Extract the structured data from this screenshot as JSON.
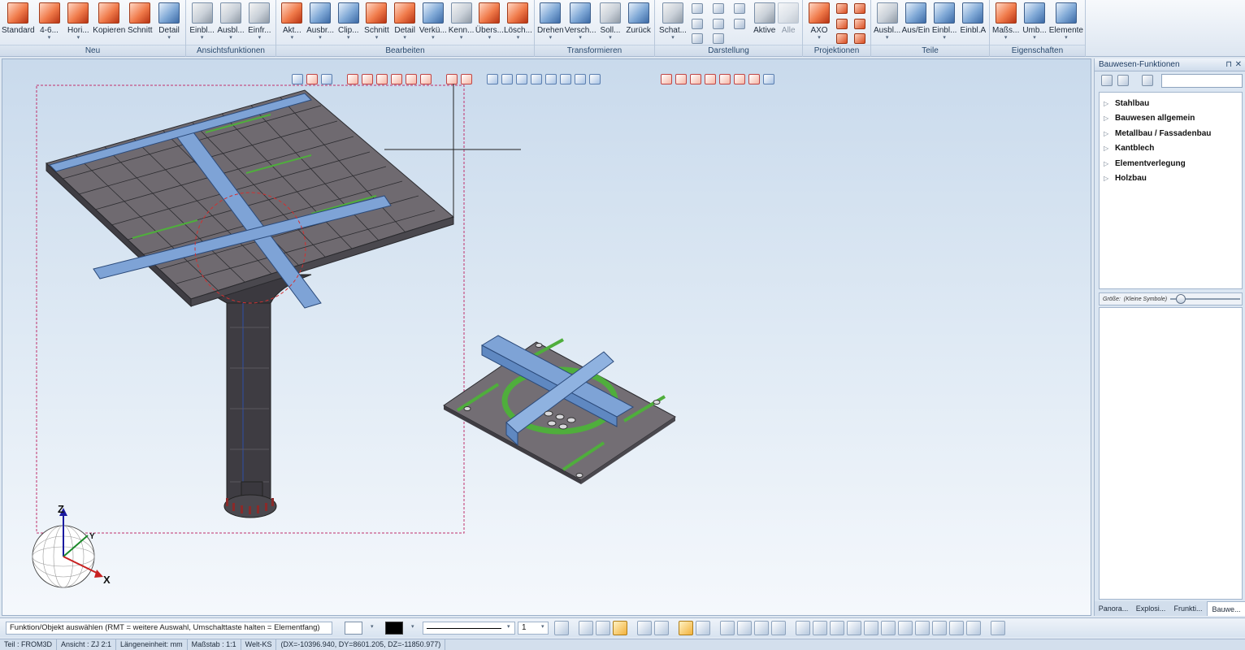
{
  "ribbon": {
    "groups": [
      {
        "label": "Neu",
        "buttons": [
          "Standard",
          "4-6...",
          "Hori...",
          "Kopieren",
          "Schnitt",
          "Detail"
        ]
      },
      {
        "label": "Ansichtsfunktionen",
        "buttons": [
          "Einbl...",
          "Ausbl...",
          "Einfr..."
        ]
      },
      {
        "label": "Bearbeiten",
        "buttons": [
          "Akt...",
          "Ausbr...",
          "Clip...",
          "Schnitt",
          "Detail",
          "Verkü...",
          "Kenn...",
          "Übers...",
          "Lösch..."
        ]
      },
      {
        "label": "Transformieren",
        "buttons": [
          "Drehen",
          "Versch...",
          "Soll...",
          "Zurück"
        ]
      },
      {
        "label": "Darstellung",
        "buttons": [
          "Schat...",
          "Aktive",
          "Alle"
        ]
      },
      {
        "label": "Projektionen",
        "buttons": [
          "AXO"
        ]
      },
      {
        "label": "Teile",
        "buttons": [
          "Ausbl...",
          "Aus/Ein",
          "Einbl...",
          "Einbl.A"
        ]
      },
      {
        "label": "Eigenschaften",
        "buttons": [
          "Maßs...",
          "Umb...",
          "Elemente"
        ]
      }
    ]
  },
  "viewport": {
    "axes": {
      "z": "Z",
      "y": "Y",
      "x": "X"
    }
  },
  "panel": {
    "title": "Bauwesen-Funktionen",
    "pin": "⊓",
    "close": "✕",
    "tree": [
      "Stahlbau",
      "Bauwesen allgemein",
      "Metallbau / Fassadenbau",
      "Kantblech",
      "Elementverlegung",
      "Holzbau"
    ],
    "size_label": "Größe:",
    "size_value": "(Kleine Symbole)",
    "size_level": 0.1,
    "tabs": [
      "Panora...",
      "Explosi...",
      "Frunkti...",
      "Bauwe..."
    ],
    "active_tab": 3
  },
  "cmdbar": {
    "prompt": "Funktion/Objekt auswählen (RMT = weitere Auswahl, Umschalttaste halten = Elementfang)",
    "pen_color": "#000000",
    "line_width": "1"
  },
  "status": {
    "teil": "Teil : FROM3D",
    "ansicht": "Ansicht : ZJ 2:1",
    "laenge": "Längeneinheit: mm",
    "massstab": "Maßstab : 1:1",
    "ks": "Welt-KS",
    "coords": "(DX=-10396.940, DY=8601.205, DZ=-11850.977)"
  },
  "colors": {
    "accent": "#3c6aa6",
    "steel_blue": "#7ea3d6",
    "plate": "#6f6a70",
    "selection": "#c0306b"
  }
}
